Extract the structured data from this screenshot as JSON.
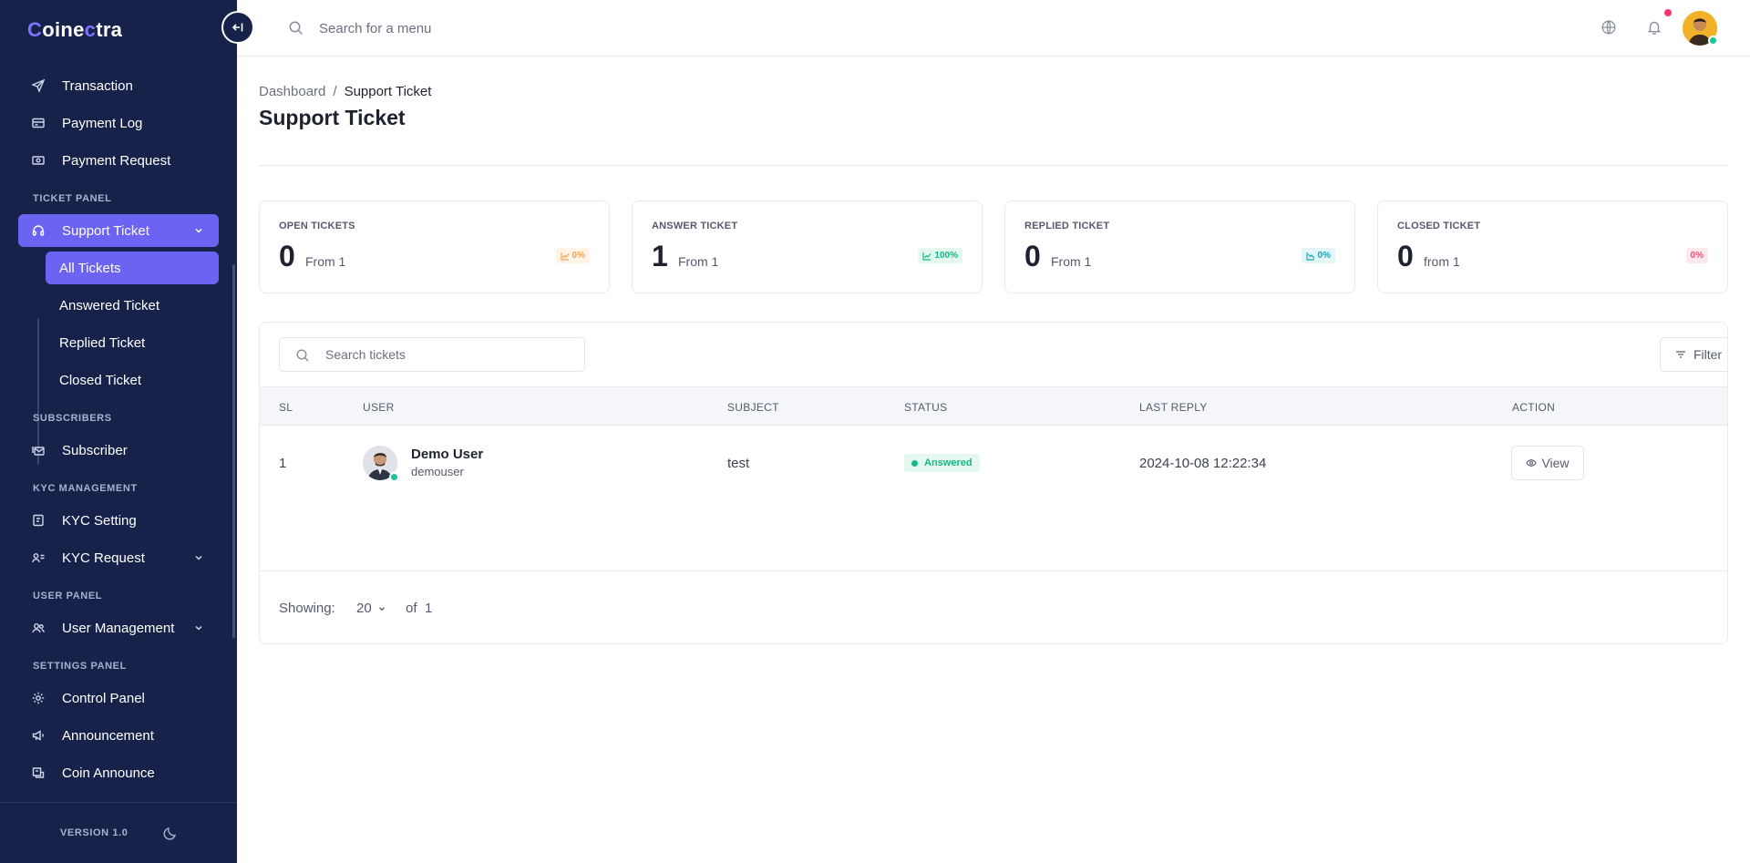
{
  "app": {
    "logo_first": "C",
    "logo_mid": "oine",
    "logo_c": "c",
    "logo_end": "tra"
  },
  "sidebar": {
    "items_top": [
      {
        "label": "Transaction",
        "icon": "send-icon"
      },
      {
        "label": "Payment Log",
        "icon": "card-icon"
      },
      {
        "label": "Payment Request",
        "icon": "cash-icon"
      }
    ],
    "section_ticket": "TICKET PANEL",
    "support_ticket": "Support Ticket",
    "sub_items": [
      {
        "label": "All Tickets"
      },
      {
        "label": "Answered Ticket"
      },
      {
        "label": "Replied Ticket"
      },
      {
        "label": "Closed Ticket"
      }
    ],
    "section_subscribers": "SUBSCRIBERS",
    "subscriber": "Subscriber",
    "section_kyc": "KYC MANAGEMENT",
    "kyc_setting": "KYC Setting",
    "kyc_request": "KYC Request",
    "section_user": "USER PANEL",
    "user_management": "User Management",
    "section_settings": "SETTINGS PANEL",
    "control_panel": "Control Panel",
    "announcement": "Announcement",
    "coin_announce": "Coin Announce",
    "version": "VERSION 1.0"
  },
  "topbar": {
    "search_placeholder": "Search for a menu"
  },
  "page": {
    "breadcrumb_root": "Dashboard",
    "breadcrumb_sep": "/",
    "breadcrumb_current": "Support Ticket",
    "title": "Support Ticket"
  },
  "stats": [
    {
      "label": "OPEN TICKETS",
      "value": "0",
      "from": "From 1",
      "badge": "0%"
    },
    {
      "label": "ANSWER TICKET",
      "value": "1",
      "from": "From 1",
      "badge": "100%"
    },
    {
      "label": "REPLIED TICKET",
      "value": "0",
      "from": "From 1",
      "badge": "0%"
    },
    {
      "label": "CLOSED TICKET",
      "value": "0",
      "from": "from 1",
      "badge": "0%"
    }
  ],
  "table": {
    "search_placeholder": "Search tickets",
    "filter_label": "Filter",
    "headers": [
      "SL",
      "USER",
      "SUBJECT",
      "STATUS",
      "LAST REPLY",
      "ACTION"
    ],
    "rows": [
      {
        "sl": "1",
        "user_name": "Demo User",
        "user_handle": "demouser",
        "subject": "test",
        "status": "Answered",
        "last_reply": "2024-10-08 12:22:34",
        "action": "View"
      }
    ],
    "showing_label": "Showing:",
    "per_page": "20",
    "of_label": "of",
    "total": "1"
  },
  "colors": {
    "sidebar_bg": "#17224a",
    "accent": "#6c63f2",
    "success": "#14b885",
    "danger": "#ef4b73",
    "warning": "#f4a14a"
  }
}
